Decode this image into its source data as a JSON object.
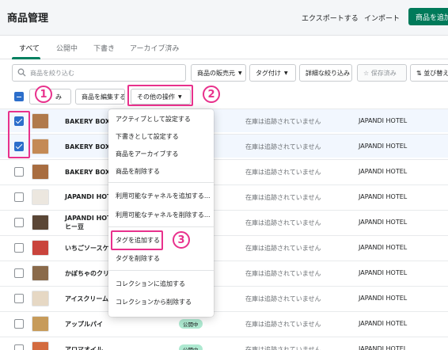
{
  "header": {
    "title": "商品管理",
    "export_label": "エクスポートする",
    "import_label": "インポート",
    "add_label": "商品を追加"
  },
  "tabs": [
    "すべて",
    "公開中",
    "下書き",
    "アーカイブ済み"
  ],
  "filters": {
    "search_placeholder": "商品を絞り込む",
    "sales_channel": "商品の販売元",
    "tagged": "タグ付け",
    "more_filters": "詳細な絞り込み",
    "saved": "保存済み",
    "sort": "並び替え"
  },
  "bulk": {
    "selected_suffix": "み",
    "edit_products": "商品を編集する",
    "more_actions": "その他の操作"
  },
  "menu": {
    "items": [
      "アクティブとして設定する",
      "下書きとして設定する",
      "商品をアーカイブする",
      "商品を削除する",
      "利用可能なチャネルを追加する...",
      "利用可能なチャネルを削除する...",
      "タグを追加する",
      "タグを削除する",
      "コレクションに追加する",
      "コレクションから削除する"
    ]
  },
  "rows": [
    {
      "name": "BAKERY BOX タ",
      "checked": true,
      "stock": "在庫は追跡されていません",
      "vendor": "JAPANDI HOTEL"
    },
    {
      "name": "BAKERY BOX タ",
      "checked": true,
      "stock": "在庫は追跡されていません",
      "vendor": "JAPANDI HOTEL"
    },
    {
      "name": "BAKERY BOX タ",
      "checked": false,
      "stock": "在庫は追跡されていません",
      "vendor": "JAPANDI HOTEL"
    },
    {
      "name": "JAPANDI HOTEL",
      "checked": false,
      "stock": "在庫は追跡されていません",
      "vendor": "JAPANDI HOTEL"
    },
    {
      "name": "JAPANDI HOTEL",
      "name2": "ヒー豆",
      "checked": false,
      "stock": "在庫は追跡されていません",
      "vendor": "JAPANDI HOTEL"
    },
    {
      "name": "いちごソースケ",
      "checked": false,
      "stock": "在庫は追跡されていません",
      "vendor": "JAPANDI HOTEL"
    },
    {
      "name": "かぼちゃのクリ",
      "checked": false,
      "stock": "在庫は追跡されていません",
      "vendor": "JAPANDI HOTEL"
    },
    {
      "name": "アイスクリーム",
      "checked": false,
      "stock": "在庫は追跡されていません",
      "vendor": "JAPANDI HOTEL"
    },
    {
      "name": "アップルパイ",
      "checked": false,
      "badge": "公開中",
      "stock": "在庫は追跡されていません",
      "vendor": "JAPANDI HOTEL"
    },
    {
      "name": "アロマオイル",
      "checked": false,
      "badge": "公開中",
      "stock": "在庫は追跡されていません",
      "vendor": "JAPANDI HOTEL"
    }
  ],
  "annotations": [
    "1",
    "2",
    "3"
  ],
  "colors": {
    "accent": "#e8318c",
    "primary": "#007a5a",
    "checkbox": "#2c6ecb",
    "badge": "#aee9d1"
  }
}
